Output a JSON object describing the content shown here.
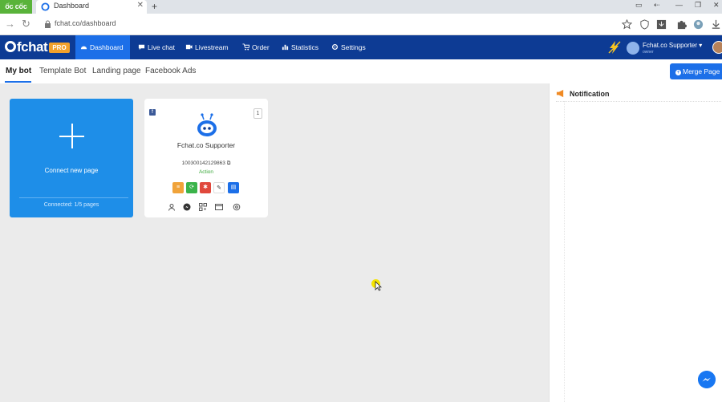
{
  "browser": {
    "brand": "ốc cốc",
    "tab_title": "Dashboard",
    "url": "fchat.co/dashboard"
  },
  "app": {
    "logo": "fchat",
    "pro_badge": "PRO",
    "nav": [
      "Dashboard",
      "Live chat",
      "Livestream",
      "Order",
      "Statistics",
      "Settings"
    ],
    "active_nav": "Dashboard",
    "user": {
      "name": "Fchat.co Supporter",
      "role": "owner"
    }
  },
  "subtabs": [
    "My bot",
    "Template Bot",
    "Landing page",
    "Facebook Ads"
  ],
  "active_subtab": "My bot",
  "merge_button": "Merge Page",
  "connect_card": {
    "label": "Connect new page",
    "status": "Connected: 1/5 pages"
  },
  "page_card": {
    "name": "Fchat.co Supporter",
    "page_id": "100300142129863",
    "action": "Action",
    "count": "1",
    "action_colors": [
      "#f0a33a",
      "#3bb34a",
      "#e0483c",
      "#ffffff",
      "#1c6fe8"
    ]
  },
  "notification": {
    "title": "Notification"
  },
  "colors": {
    "header": "#0d3b94",
    "accent": "#1c6fe8",
    "card": "#1e8ee8"
  }
}
